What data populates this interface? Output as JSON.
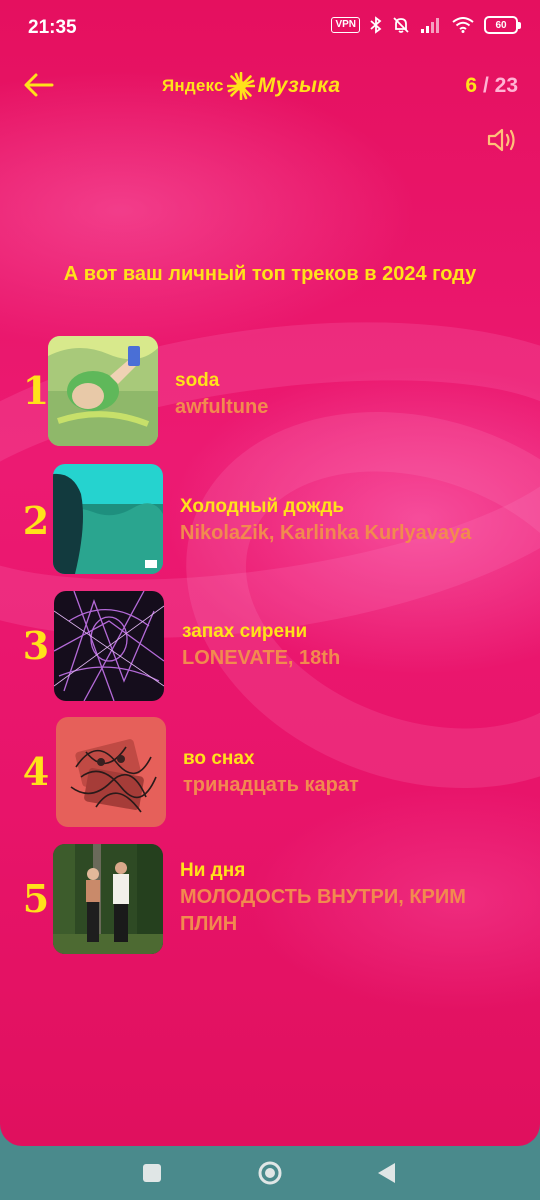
{
  "status": {
    "time": "21:35",
    "vpn": "VPN",
    "battery": "60"
  },
  "header": {
    "logo_left": "Яндекс",
    "logo_right": "Музыка",
    "page_current": "6",
    "page_sep": "/",
    "page_total": "23"
  },
  "intro": "А вот ваш личный топ треков в 2024 году",
  "tracks": [
    {
      "rank": "1",
      "title": "soda",
      "artist": "awfultune"
    },
    {
      "rank": "2",
      "title": "Холодный дождь",
      "artist": "NikolaZik, Karlinka Kurlyavaya"
    },
    {
      "rank": "3",
      "title": "запах сирени",
      "artist": "LONEVATE, 18th"
    },
    {
      "rank": "4",
      "title": "во снах",
      "artist": "тринадцать карат"
    },
    {
      "rank": "5",
      "title": "Ни дня",
      "artist": "МОЛОДОСТЬ ВНУТРИ, КРИМ ПЛИН"
    }
  ],
  "colors": {
    "background": "#e8146a",
    "accent_yellow": "#ffe21a",
    "artist_orange": "#f28a4f",
    "nav_bar": "#4a8a8c"
  },
  "icons": {
    "back": "arrow-left-icon",
    "sound": "speaker-icon",
    "nav": [
      "square-icon",
      "circle-icon",
      "triangle-back-icon"
    ]
  }
}
